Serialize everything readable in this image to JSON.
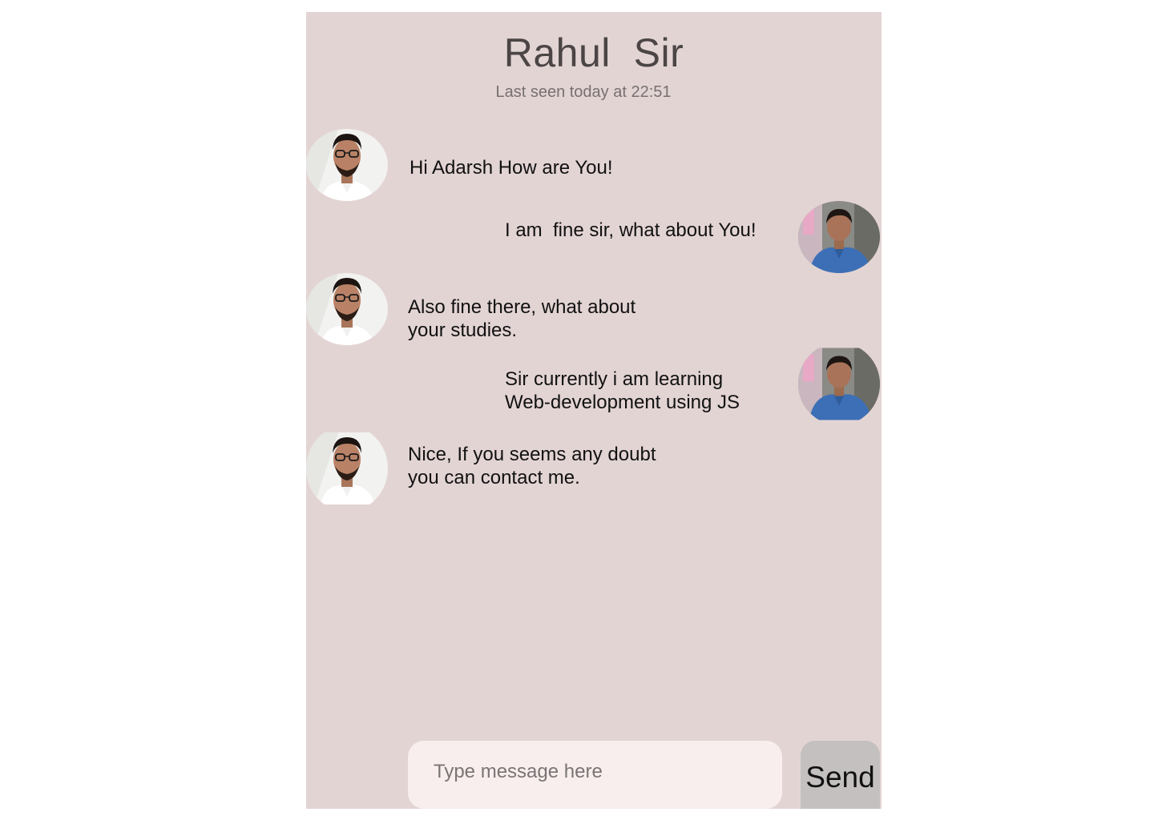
{
  "header": {
    "contact_name": "Rahul  Sir",
    "status": "Last seen today at 22:51"
  },
  "messages": [
    {
      "sender": "Rahul Sir",
      "side": "left",
      "avatar": "contact-avatar",
      "text": "Hi Adarsh How are You!"
    },
    {
      "sender": "me",
      "side": "right",
      "avatar": "user-avatar",
      "text": "I am  fine sir, what about You!"
    },
    {
      "sender": "Rahul Sir",
      "side": "left",
      "avatar": "contact-avatar",
      "text": "Also fine there, what about\nyour studies."
    },
    {
      "sender": "me",
      "side": "right",
      "avatar": "user-avatar",
      "text": "Sir currently i am learning\nWeb-development using JS"
    },
    {
      "sender": "Rahul Sir",
      "side": "left",
      "avatar": "contact-avatar",
      "text": "Nice, If you seems any doubt\nyou can contact me."
    }
  ],
  "composer": {
    "placeholder": "Type message here",
    "value": "",
    "send_label": "Send"
  },
  "colors": {
    "panel_bg": "#e3d4d4",
    "input_bg": "#f8eeee",
    "send_bg": "#c4c0c0",
    "title_color": "#4b4545"
  }
}
